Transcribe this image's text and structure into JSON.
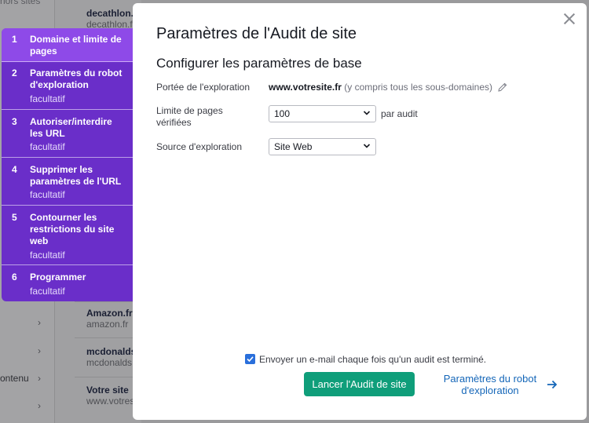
{
  "background": {
    "top_fragment": "hors sites",
    "rows": [
      {
        "name": "decathlon.fr",
        "url": "decathlon.fr"
      },
      {
        "name": "Amazon.fr",
        "url": "amazon.fr"
      },
      {
        "name": "mcdonalds.fr",
        "url": "mcdonalds.fr"
      },
      {
        "name": "Votre site",
        "url": "www.votresite.fr"
      }
    ],
    "left_text": "ontenu"
  },
  "modal": {
    "title": "Paramètres de l'Audit de site",
    "section_title": "Configurer les paramètres de base",
    "scope": {
      "label": "Portée de l'exploration",
      "domain": "www.votresite.fr",
      "hint": "(y compris tous les sous-domaines)"
    },
    "page_limit": {
      "label": "Limite de pages vérifiées",
      "value": "100",
      "suffix": "par audit"
    },
    "crawl_source": {
      "label": "Source d'exploration",
      "value": "Site Web"
    },
    "email_checkbox": {
      "checked": true,
      "label": "Envoyer un e-mail chaque fois qu'un audit est terminé."
    },
    "launch_button": "Lancer l'Audit de site",
    "next_link": "Paramètres du robot d'exploration"
  },
  "steps": [
    {
      "num": "1",
      "label": "Domaine et limite de pages",
      "optional": "",
      "active": true
    },
    {
      "num": "2",
      "label": "Paramètres du robot d'exploration",
      "optional": "facultatif",
      "active": false
    },
    {
      "num": "3",
      "label": "Autoriser/interdire les URL",
      "optional": "facultatif",
      "active": false
    },
    {
      "num": "4",
      "label": "Supprimer les paramètres de l'URL",
      "optional": "facultatif",
      "active": false
    },
    {
      "num": "5",
      "label": "Contourner les restrictions du site web",
      "optional": "facultatif",
      "active": false
    },
    {
      "num": "6",
      "label": "Programmer",
      "optional": "facultatif",
      "active": false
    }
  ],
  "colors": {
    "accent_purple": "#6a2ec9",
    "active_step": "#8e4ae8",
    "primary_green": "#0f9e7a",
    "link_blue": "#1466b8",
    "checkbox_blue": "#2a6fdb"
  }
}
